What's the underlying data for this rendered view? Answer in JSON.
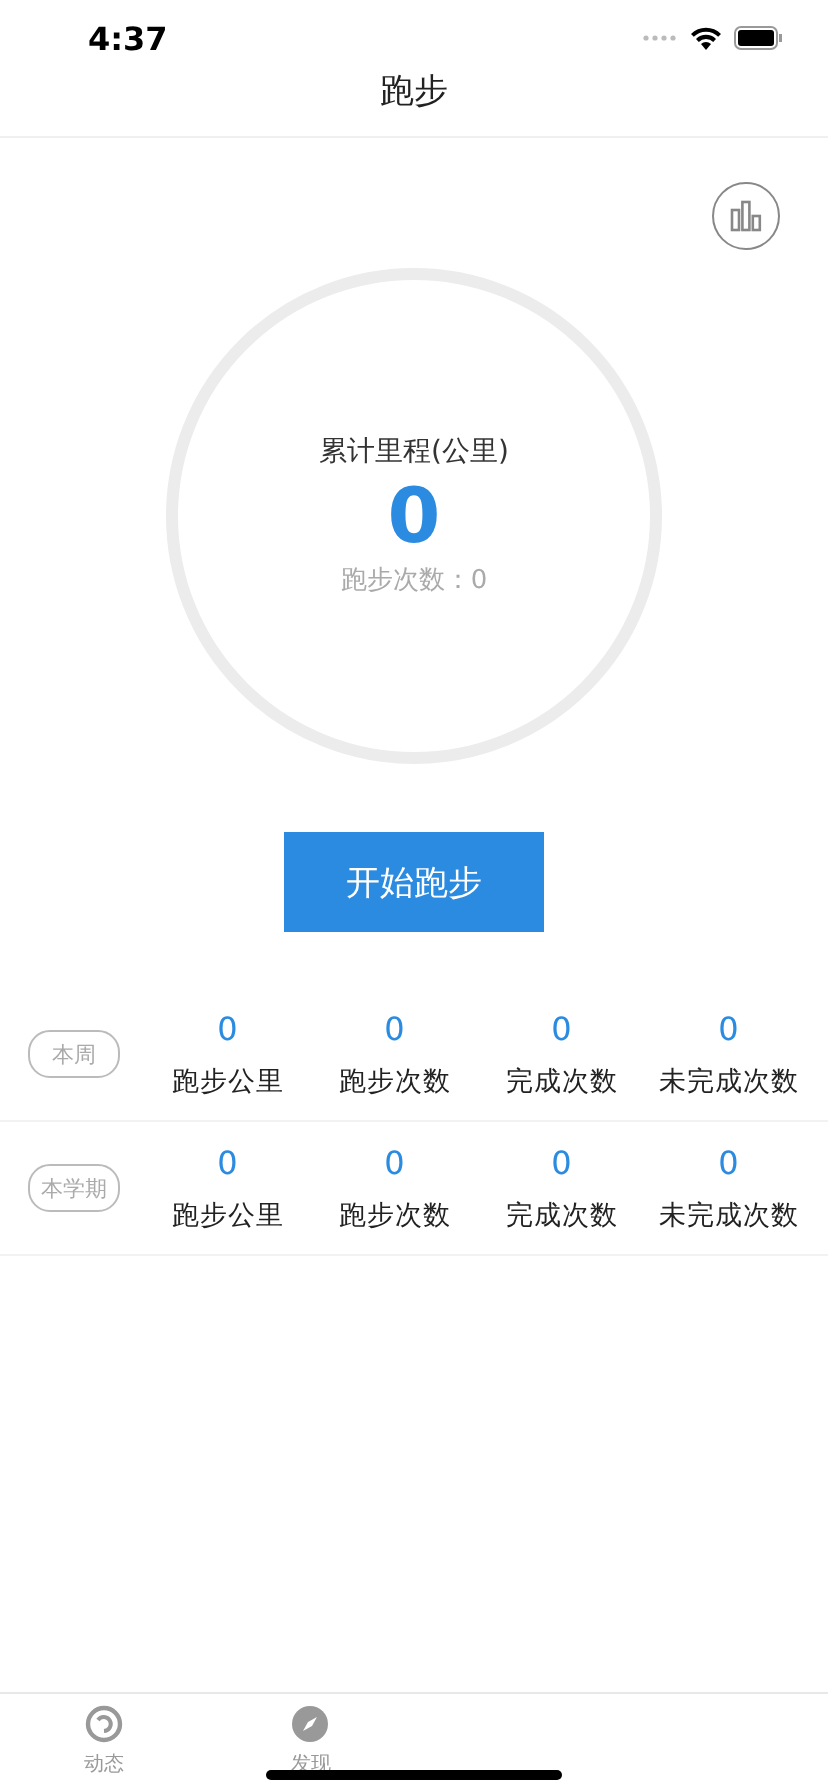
{
  "status_bar": {
    "time": "4:37"
  },
  "nav": {
    "title": "跑步"
  },
  "summary": {
    "label": "累计里程(公里)",
    "value": "0",
    "runs_label": "跑步次数：0"
  },
  "start_button": "开始跑步",
  "periods": [
    {
      "label": "本周",
      "stats": [
        {
          "value": "0",
          "label": "跑步公里"
        },
        {
          "value": "0",
          "label": "跑步次数"
        },
        {
          "value": "0",
          "label": "完成次数"
        },
        {
          "value": "0",
          "label": "未完成次数"
        }
      ]
    },
    {
      "label": "本学期",
      "stats": [
        {
          "value": "0",
          "label": "跑步公里"
        },
        {
          "value": "0",
          "label": "跑步次数"
        },
        {
          "value": "0",
          "label": "完成次数"
        },
        {
          "value": "0",
          "label": "未完成次数"
        }
      ]
    }
  ],
  "tab_bar": [
    {
      "kind": "gauge",
      "label": "动态"
    },
    {
      "kind": "compass",
      "label": "发现"
    }
  ]
}
